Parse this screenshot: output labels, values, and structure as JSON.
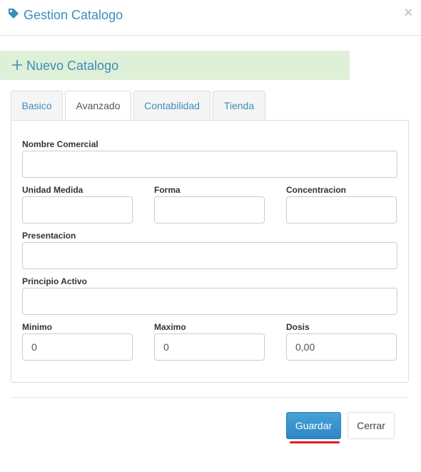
{
  "modal": {
    "title": "Gestion Catalogo",
    "close_label": "×"
  },
  "callout": {
    "text": "Nuevo Catalogo"
  },
  "tabs": [
    {
      "label": "Basico",
      "active": false
    },
    {
      "label": "Avanzado",
      "active": true
    },
    {
      "label": "Contabilidad",
      "active": false
    },
    {
      "label": "Tienda",
      "active": false
    }
  ],
  "form": {
    "nombre_comercial": {
      "label": "Nombre Comercial",
      "value": ""
    },
    "unidad_medida": {
      "label": "Unidad Medida",
      "value": ""
    },
    "forma": {
      "label": "Forma",
      "value": ""
    },
    "concentracion": {
      "label": "Concentracion",
      "value": ""
    },
    "presentacion": {
      "label": "Presentacion",
      "value": ""
    },
    "principio_activo": {
      "label": "Principio Activo",
      "value": ""
    },
    "minimo": {
      "label": "Minimo",
      "value": "0"
    },
    "maximo": {
      "label": "Maximo",
      "value": "0"
    },
    "dosis": {
      "label": "Dosis",
      "value": "0,00"
    }
  },
  "footer": {
    "save_label": "Guardar",
    "close_label": "Cerrar"
  },
  "colors": {
    "accent": "#3c8dbc",
    "callout_bg": "#dff0d8",
    "underline": "#e11b1b"
  },
  "icons": {
    "title": "tag-icon",
    "callout": "plus-icon"
  }
}
